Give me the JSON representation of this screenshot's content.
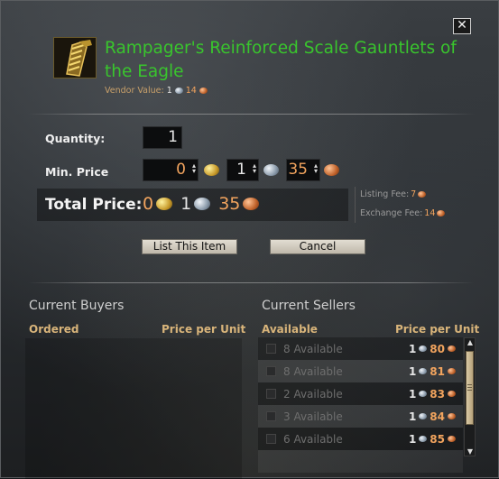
{
  "window": {
    "close_label": "✕"
  },
  "item": {
    "name": "Rampager's Reinforced Scale Gauntlets of the Eagle",
    "vendor_label": "Vendor Value:",
    "vendor_silver": "1",
    "vendor_copper": "14"
  },
  "form": {
    "quantity_label": "Quantity:",
    "quantity_value": "1",
    "min_price_label": "Min. Price",
    "min_gold": "0",
    "min_silver": "1",
    "min_copper": "35",
    "total_label": "Total Price:",
    "total_gold": "0",
    "total_silver": "1",
    "total_copper": "35",
    "listing_fee_label": "Listing Fee:",
    "listing_fee": "7",
    "exchange_fee_label": "Exchange Fee:",
    "exchange_fee": "14"
  },
  "buttons": {
    "list": "List This Item",
    "cancel": "Cancel"
  },
  "buyers": {
    "title": "Current Buyers",
    "col_ordered": "Ordered",
    "col_price": "Price per Unit"
  },
  "sellers": {
    "title": "Current Sellers",
    "col_available": "Available",
    "col_price": "Price per Unit",
    "rows": [
      {
        "available": "8 Available",
        "silver": "1",
        "copper": "80"
      },
      {
        "available": "8 Available",
        "silver": "1",
        "copper": "81"
      },
      {
        "available": "2 Available",
        "silver": "1",
        "copper": "83"
      },
      {
        "available": "3 Available",
        "silver": "1",
        "copper": "84"
      },
      {
        "available": "6 Available",
        "silver": "1",
        "copper": "85"
      }
    ]
  },
  "colors": {
    "title_green": "#39c52d",
    "copper_orange": "#f2a45e",
    "header_gold": "#d8b47a"
  },
  "icons": [
    "close-icon",
    "gauntlets-item-icon",
    "gold-coin-icon",
    "silver-coin-icon",
    "copper-coin-icon",
    "scroll-up-icon",
    "scroll-down-icon"
  ]
}
